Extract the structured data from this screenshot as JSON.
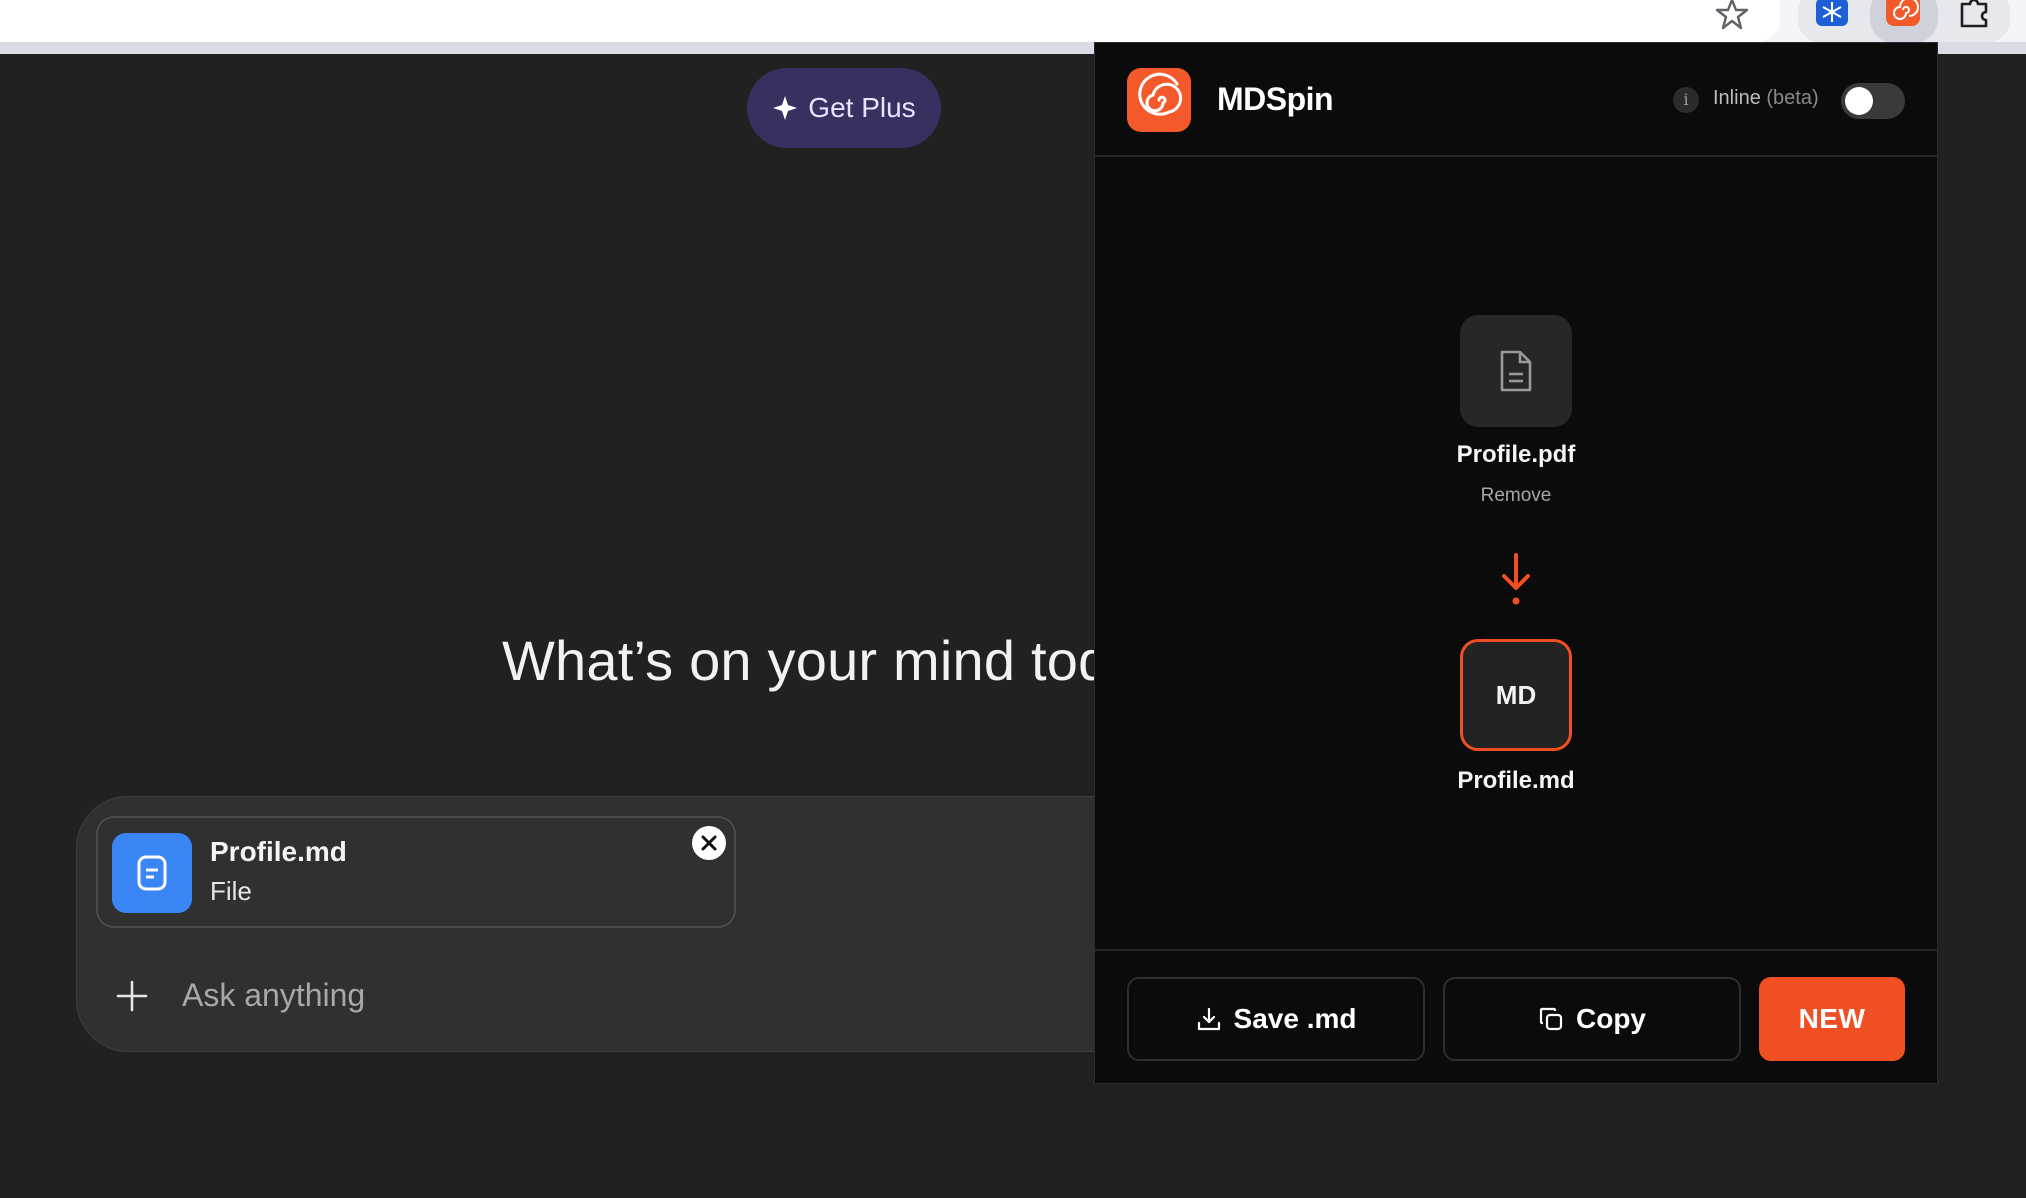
{
  "page": {
    "get_plus_label": "Get Plus",
    "headline": "What’s on your mind tod",
    "attachment": {
      "name": "Profile.md",
      "type": "File"
    },
    "composer": {
      "placeholder": "Ask anything"
    }
  },
  "browser": {
    "icons": [
      "star-icon",
      "snowflake-extension-icon",
      "mdspin-extension-icon",
      "puzzle-icon"
    ]
  },
  "popup": {
    "app_name": "MDSpin",
    "inline_label": "Inline",
    "inline_beta": "(beta)",
    "inline_enabled": false,
    "info_glyph": "i",
    "source_file": {
      "name": "Profile.pdf",
      "remove_label": "Remove"
    },
    "output_file": {
      "badge": "MD",
      "name": "Profile.md"
    },
    "buttons": {
      "save": "Save .md",
      "copy": "Copy",
      "new": "NEW"
    },
    "colors": {
      "accent": "#f04e23",
      "background": "#0b0b0b"
    }
  }
}
